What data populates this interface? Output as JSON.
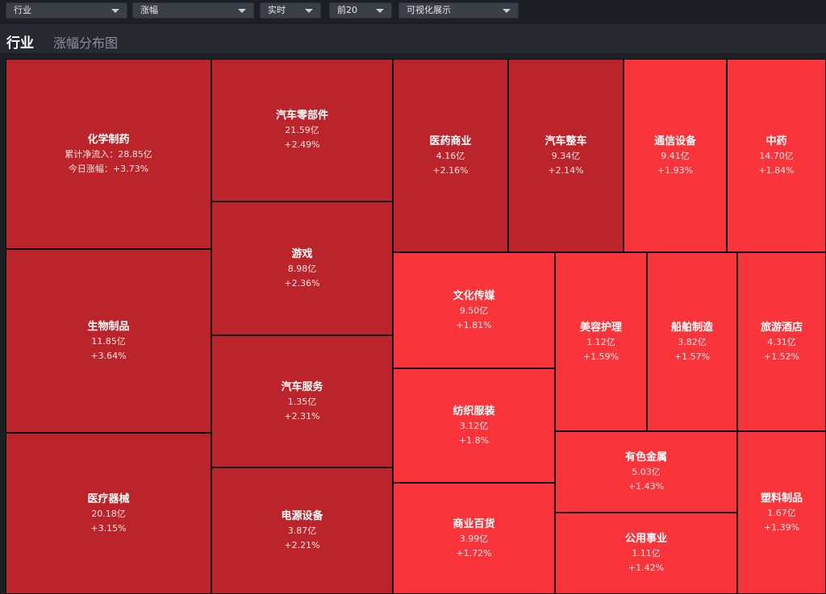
{
  "toolbar": {
    "dropdowns": [
      {
        "value": "行业"
      },
      {
        "value": "涨幅"
      },
      {
        "value": "实时"
      },
      {
        "value": "前20"
      },
      {
        "value": "可视化展示"
      }
    ]
  },
  "header": {
    "title": "行业",
    "subtitle": "涨幅分布图"
  },
  "treemap": {
    "first_tile_labels": {
      "inflow": "累计净流入：28.85亿",
      "change": "今日涨幅：+3.73%"
    },
    "tiles": [
      {
        "name": "化学制药",
        "inflow": "28.85亿",
        "change": "+3.73%"
      },
      {
        "name": "生物制品",
        "inflow": "11.85亿",
        "change": "+3.64%"
      },
      {
        "name": "医疗器械",
        "inflow": "20.18亿",
        "change": "+3.15%"
      },
      {
        "name": "汽车零部件",
        "inflow": "21.59亿",
        "change": "+2.49%"
      },
      {
        "name": "游戏",
        "inflow": "8.98亿",
        "change": "+2.36%"
      },
      {
        "name": "汽车服务",
        "inflow": "1.35亿",
        "change": "+2.31%"
      },
      {
        "name": "电源设备",
        "inflow": "3.87亿",
        "change": "+2.21%"
      },
      {
        "name": "医药商业",
        "inflow": "4.16亿",
        "change": "+2.16%"
      },
      {
        "name": "汽车整车",
        "inflow": "9.34亿",
        "change": "+2.14%"
      },
      {
        "name": "通信设备",
        "inflow": "9.41亿",
        "change": "+1.93%"
      },
      {
        "name": "中药",
        "inflow": "14.70亿",
        "change": "+1.84%"
      },
      {
        "name": "文化传媒",
        "inflow": "9.50亿",
        "change": "+1.81%"
      },
      {
        "name": "纺织服装",
        "inflow": "3.12亿",
        "change": "+1.8%"
      },
      {
        "name": "商业百货",
        "inflow": "3.99亿",
        "change": "+1.72%"
      },
      {
        "name": "美容护理",
        "inflow": "1.12亿",
        "change": "+1.59%"
      },
      {
        "name": "船舶制造",
        "inflow": "3.82亿",
        "change": "+1.57%"
      },
      {
        "name": "旅游酒店",
        "inflow": "4.31亿",
        "change": "+1.52%"
      },
      {
        "name": "有色金属",
        "inflow": "5.03亿",
        "change": "+1.43%"
      },
      {
        "name": "公用事业",
        "inflow": "1.11亿",
        "change": "+1.42%"
      },
      {
        "name": "塑料制品",
        "inflow": "1.67亿",
        "change": "+1.39%"
      }
    ]
  },
  "colors": {
    "strong_up": "#bb242a",
    "up": "#f9343a"
  }
}
